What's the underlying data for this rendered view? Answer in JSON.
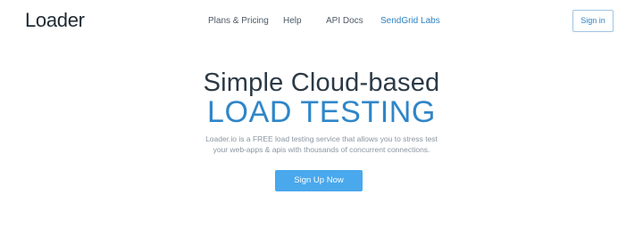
{
  "header": {
    "logo": "Loader",
    "nav": [
      {
        "label": "Plans & Pricing"
      },
      {
        "label": "Help"
      },
      {
        "label": "API Docs"
      },
      {
        "label": "SendGrid Labs"
      }
    ],
    "signin_label": "Sign in"
  },
  "hero": {
    "title": "Simple Cloud-based",
    "subtitle": "LOAD TESTING",
    "description_line1": "Loader.io is a FREE load testing service that allows you to stress test",
    "description_line2": "your web-apps & apis with thousands of concurrent connections.",
    "cta_label": "Sign Up Now"
  },
  "colors": {
    "accent": "#2f83c4",
    "cta_background": "#4aa8ec",
    "text_dark": "#2c3a46",
    "text_muted": "#8a96a1"
  }
}
